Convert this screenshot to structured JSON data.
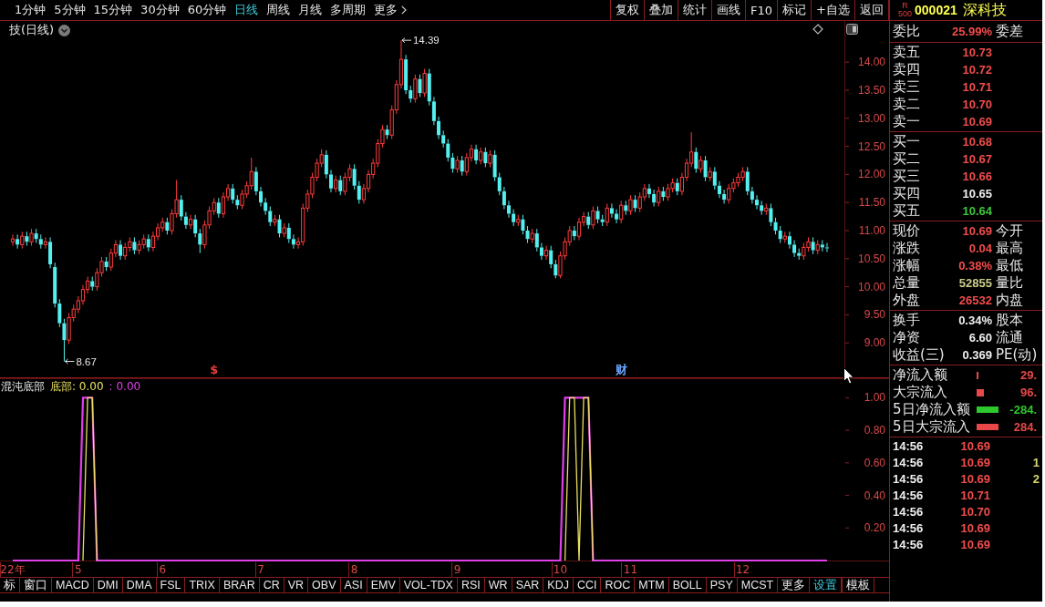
{
  "period_bar": {
    "periods": [
      {
        "label": "1分钟",
        "selected": false
      },
      {
        "label": "5分钟",
        "selected": false
      },
      {
        "label": "15分钟",
        "selected": false
      },
      {
        "label": "30分钟",
        "selected": false
      },
      {
        "label": "60分钟",
        "selected": false
      },
      {
        "label": "日线",
        "selected": true
      },
      {
        "label": "周线",
        "selected": false
      },
      {
        "label": "月线",
        "selected": false
      },
      {
        "label": "多周期",
        "selected": false
      }
    ],
    "more": "更多"
  },
  "toolbar": [
    "复权",
    "叠加",
    "统计",
    "画线",
    "F10",
    "标记",
    "+自选",
    "返回"
  ],
  "price_chart": {
    "title": "技(日线)",
    "marker_styles": [
      {
        "color": "#e83c3c"
      },
      {
        "color": "#6aa8ff"
      }
    ],
    "chart_data": {
      "type": "candlestick",
      "ylim": [
        8.37,
        14.75
      ],
      "yticks": [
        {
          "value": 9,
          "label": "9.00"
        },
        {
          "value": 9.5,
          "label": "9.50"
        },
        {
          "value": 10,
          "label": "10.00"
        },
        {
          "value": 10.5,
          "label": "10.50"
        },
        {
          "value": 11,
          "label": "11.00"
        },
        {
          "value": 11.5,
          "label": "11.50"
        },
        {
          "value": 12,
          "label": "12.00"
        },
        {
          "value": 12.5,
          "label": "12.50"
        },
        {
          "value": 13,
          "label": "13.00"
        },
        {
          "value": 13.5,
          "label": "13.50"
        },
        {
          "value": 14,
          "label": "14.00"
        }
      ],
      "categories": [
        null,
        null,
        null,
        null,
        null,
        null,
        null,
        null,
        null,
        null,
        null,
        null,
        null,
        null,
        null,
        null,
        null,
        null,
        null,
        null,
        null,
        null,
        null,
        null,
        null,
        null,
        null,
        null,
        null,
        null,
        null,
        null,
        null,
        null,
        null,
        null,
        null,
        null,
        null,
        null,
        null,
        null,
        null,
        "$",
        null,
        null,
        null,
        null,
        null,
        null,
        null,
        null,
        null,
        null,
        null,
        null,
        null,
        null,
        null,
        null,
        null,
        null,
        null,
        null,
        null,
        null,
        null,
        null,
        null,
        null,
        null,
        null,
        null,
        null,
        null,
        null,
        null,
        null,
        null,
        null,
        null,
        null,
        null,
        null,
        null,
        null,
        null,
        null,
        null,
        null,
        null,
        null,
        null,
        null,
        null,
        null,
        null,
        null,
        null,
        null,
        null,
        null,
        null,
        null,
        null,
        null,
        null,
        null,
        null,
        null,
        null,
        null,
        null,
        null,
        null,
        null,
        null,
        null,
        null,
        null,
        null,
        null,
        null,
        null,
        null,
        null,
        null,
        null,
        null,
        null,
        "财",
        null,
        null,
        null,
        null,
        null,
        null,
        null,
        null,
        null,
        null,
        null,
        null,
        null,
        null,
        null,
        null,
        null,
        null,
        null,
        null,
        null,
        null,
        null,
        null,
        null,
        null,
        null,
        null,
        null,
        null,
        null,
        null,
        null,
        null,
        null,
        null,
        null,
        null,
        null,
        null,
        null,
        null,
        null,
        null
      ],
      "ohlc": [
        [
          10.8,
          10.93,
          10.73,
          10.85
        ],
        [
          10.85,
          10.93,
          10.68,
          10.75
        ],
        [
          10.75,
          10.98,
          10.68,
          10.9
        ],
        [
          10.9,
          10.98,
          10.73,
          10.8
        ],
        [
          10.8,
          11.03,
          10.73,
          10.95
        ],
        [
          10.95,
          11.03,
          10.78,
          10.85
        ],
        [
          10.85,
          10.93,
          10.68,
          10.75
        ],
        [
          10.75,
          10.88,
          10.68,
          10.8
        ],
        [
          10.8,
          10.88,
          10.33,
          10.4
        ],
        [
          10.35,
          10.43,
          9.63,
          9.7
        ],
        [
          9.7,
          9.78,
          9.28,
          9.35
        ],
        [
          9.35,
          9.43,
          8.67,
          9.05
        ],
        [
          9.05,
          9.53,
          8.98,
          9.45
        ],
        [
          9.45,
          9.68,
          9.38,
          9.6
        ],
        [
          9.6,
          9.83,
          9.53,
          9.75
        ],
        [
          9.75,
          10.03,
          9.68,
          9.95
        ],
        [
          9.95,
          10.18,
          9.88,
          10.1
        ],
        [
          10.1,
          10.18,
          9.93,
          10.0
        ],
        [
          10.0,
          10.33,
          9.93,
          10.25
        ],
        [
          10.25,
          10.53,
          10.18,
          10.45
        ],
        [
          10.45,
          10.53,
          10.28,
          10.35
        ],
        [
          10.35,
          10.68,
          10.28,
          10.6
        ],
        [
          10.6,
          10.83,
          10.53,
          10.75
        ],
        [
          10.75,
          10.83,
          10.48,
          10.55
        ],
        [
          10.55,
          10.78,
          10.48,
          10.7
        ],
        [
          10.7,
          10.88,
          10.63,
          10.8
        ],
        [
          10.8,
          10.88,
          10.58,
          10.65
        ],
        [
          10.65,
          10.83,
          10.58,
          10.75
        ],
        [
          10.75,
          10.93,
          10.68,
          10.85
        ],
        [
          10.85,
          10.93,
          10.63,
          10.7
        ],
        [
          10.7,
          10.98,
          10.63,
          10.9
        ],
        [
          10.9,
          11.13,
          10.83,
          11.05
        ],
        [
          11.05,
          11.23,
          10.98,
          11.15
        ],
        [
          11.15,
          11.23,
          10.93,
          11.0
        ],
        [
          11.0,
          11.38,
          10.93,
          11.3
        ],
        [
          11.3,
          11.9,
          11.23,
          11.55
        ],
        [
          11.55,
          11.63,
          11.18,
          11.25
        ],
        [
          11.25,
          11.33,
          11.03,
          11.1
        ],
        [
          11.1,
          11.28,
          11.03,
          11.2
        ],
        [
          11.2,
          11.28,
          10.88,
          10.95
        ],
        [
          10.95,
          11.03,
          10.6,
          10.75
        ],
        [
          10.75,
          11.18,
          10.68,
          11.1
        ],
        [
          11.1,
          11.43,
          11.03,
          11.35
        ],
        [
          11.35,
          11.58,
          11.28,
          11.5
        ],
        [
          11.5,
          11.58,
          11.23,
          11.3
        ],
        [
          11.3,
          11.68,
          11.23,
          11.6
        ],
        [
          11.6,
          11.83,
          11.53,
          11.75
        ],
        [
          11.75,
          11.83,
          11.48,
          11.55
        ],
        [
          11.55,
          11.63,
          11.38,
          11.45
        ],
        [
          11.45,
          11.73,
          11.38,
          11.65
        ],
        [
          11.65,
          11.88,
          11.58,
          11.8
        ],
        [
          11.8,
          12.3,
          11.73,
          12.05
        ],
        [
          12.05,
          12.13,
          11.63,
          11.7
        ],
        [
          11.7,
          11.78,
          11.43,
          11.5
        ],
        [
          11.5,
          11.58,
          11.28,
          11.35
        ],
        [
          11.35,
          11.43,
          11.08,
          11.15
        ],
        [
          11.15,
          11.28,
          11.08,
          11.2
        ],
        [
          11.2,
          11.28,
          10.88,
          10.95
        ],
        [
          10.95,
          11.13,
          10.88,
          11.05
        ],
        [
          11.05,
          11.13,
          10.78,
          10.85
        ],
        [
          10.85,
          10.93,
          10.68,
          10.75
        ],
        [
          10.75,
          10.88,
          10.68,
          10.8
        ],
        [
          10.8,
          11.48,
          10.73,
          11.4
        ],
        [
          11.4,
          11.73,
          11.33,
          11.65
        ],
        [
          11.65,
          12.03,
          11.58,
          11.95
        ],
        [
          11.95,
          12.28,
          11.88,
          12.2
        ],
        [
          12.2,
          12.45,
          12.13,
          12.35
        ],
        [
          12.35,
          12.43,
          11.93,
          12.0
        ],
        [
          12.0,
          12.08,
          11.68,
          11.75
        ],
        [
          11.75,
          11.98,
          11.68,
          11.9
        ],
        [
          11.9,
          11.98,
          11.63,
          11.7
        ],
        [
          11.7,
          12.03,
          11.63,
          11.95
        ],
        [
          11.95,
          12.18,
          11.88,
          12.1
        ],
        [
          12.1,
          12.18,
          11.73,
          11.8
        ],
        [
          11.8,
          11.88,
          11.48,
          11.55
        ],
        [
          11.55,
          11.83,
          11.48,
          11.75
        ],
        [
          11.75,
          12.08,
          11.68,
          12.0
        ],
        [
          12.0,
          12.28,
          11.93,
          12.2
        ],
        [
          12.2,
          12.63,
          12.13,
          12.55
        ],
        [
          12.55,
          12.88,
          12.48,
          12.8
        ],
        [
          12.8,
          12.88,
          12.63,
          12.7
        ],
        [
          12.7,
          13.23,
          12.63,
          13.15
        ],
        [
          13.15,
          13.68,
          13.08,
          13.6
        ],
        [
          13.6,
          14.39,
          13.53,
          14.05
        ],
        [
          14.05,
          14.13,
          13.43,
          13.5
        ],
        [
          13.5,
          13.58,
          13.28,
          13.35
        ],
        [
          13.35,
          13.78,
          13.28,
          13.7
        ],
        [
          13.7,
          13.78,
          13.38,
          13.45
        ],
        [
          13.45,
          13.88,
          13.38,
          13.8
        ],
        [
          13.8,
          13.88,
          13.23,
          13.3
        ],
        [
          13.3,
          13.38,
          12.88,
          12.95
        ],
        [
          12.95,
          13.03,
          12.63,
          12.7
        ],
        [
          12.7,
          12.78,
          12.48,
          12.55
        ],
        [
          12.55,
          12.63,
          12.23,
          12.3
        ],
        [
          12.3,
          12.38,
          12.03,
          12.1
        ],
        [
          12.1,
          12.33,
          12.03,
          12.25
        ],
        [
          12.25,
          12.33,
          11.98,
          12.05
        ],
        [
          12.05,
          12.38,
          11.98,
          12.3
        ],
        [
          12.3,
          12.53,
          12.23,
          12.45
        ],
        [
          12.45,
          12.53,
          12.18,
          12.25
        ],
        [
          12.25,
          12.48,
          12.18,
          12.4
        ],
        [
          12.4,
          12.48,
          12.13,
          12.2
        ],
        [
          12.2,
          12.43,
          12.13,
          12.35
        ],
        [
          12.35,
          12.43,
          11.88,
          11.95
        ],
        [
          11.95,
          12.03,
          11.63,
          11.7
        ],
        [
          11.7,
          11.78,
          11.38,
          11.45
        ],
        [
          11.45,
          11.53,
          11.23,
          11.3
        ],
        [
          11.3,
          11.38,
          11.08,
          11.15
        ],
        [
          11.15,
          11.28,
          11.08,
          11.2
        ],
        [
          11.2,
          11.28,
          10.93,
          11.0
        ],
        [
          11.0,
          11.08,
          10.78,
          10.85
        ],
        [
          10.85,
          11.03,
          10.78,
          10.95
        ],
        [
          10.95,
          11.03,
          10.63,
          10.7
        ],
        [
          10.7,
          10.78,
          10.48,
          10.55
        ],
        [
          10.55,
          10.73,
          10.48,
          10.65
        ],
        [
          10.65,
          10.73,
          10.33,
          10.4
        ],
        [
          10.4,
          10.48,
          10.15,
          10.2
        ],
        [
          10.2,
          10.63,
          10.15,
          10.55
        ],
        [
          10.55,
          10.88,
          10.48,
          10.8
        ],
        [
          10.8,
          11.08,
          10.73,
          11.0
        ],
        [
          11.0,
          11.08,
          10.83,
          10.9
        ],
        [
          10.9,
          11.23,
          10.83,
          11.15
        ],
        [
          11.15,
          11.33,
          11.08,
          11.25
        ],
        [
          11.25,
          11.33,
          11.03,
          11.1
        ],
        [
          11.1,
          11.43,
          11.03,
          11.35
        ],
        [
          11.35,
          11.43,
          11.13,
          11.2
        ],
        [
          11.2,
          11.28,
          11.08,
          11.15
        ],
        [
          11.15,
          11.48,
          11.08,
          11.4
        ],
        [
          11.4,
          11.48,
          11.23,
          11.3
        ],
        [
          11.3,
          11.38,
          11.13,
          11.2
        ],
        [
          11.2,
          11.53,
          11.13,
          11.45
        ],
        [
          11.45,
          11.53,
          11.28,
          11.35
        ],
        [
          11.35,
          11.63,
          11.28,
          11.55
        ],
        [
          11.55,
          11.63,
          11.33,
          11.4
        ],
        [
          11.4,
          11.68,
          11.33,
          11.6
        ],
        [
          11.6,
          11.83,
          11.53,
          11.75
        ],
        [
          11.75,
          11.83,
          11.58,
          11.65
        ],
        [
          11.65,
          11.73,
          11.43,
          11.5
        ],
        [
          11.5,
          11.78,
          11.43,
          11.7
        ],
        [
          11.7,
          11.78,
          11.53,
          11.6
        ],
        [
          11.6,
          11.83,
          11.53,
          11.75
        ],
        [
          11.75,
          11.93,
          11.68,
          11.85
        ],
        [
          11.85,
          11.93,
          11.63,
          11.7
        ],
        [
          11.7,
          12.03,
          11.63,
          11.95
        ],
        [
          11.95,
          12.28,
          11.88,
          12.2
        ],
        [
          12.2,
          12.75,
          12.13,
          12.4
        ],
        [
          12.4,
          12.48,
          12.03,
          12.1
        ],
        [
          12.1,
          12.33,
          12.03,
          12.25
        ],
        [
          12.25,
          12.33,
          11.88,
          11.95
        ],
        [
          11.95,
          12.13,
          11.88,
          12.05
        ],
        [
          12.05,
          12.13,
          11.73,
          11.8
        ],
        [
          11.8,
          11.88,
          11.58,
          11.65
        ],
        [
          11.65,
          11.73,
          11.48,
          11.55
        ],
        [
          11.55,
          11.83,
          11.48,
          11.75
        ],
        [
          11.75,
          11.93,
          11.68,
          11.85
        ],
        [
          11.85,
          12.03,
          11.78,
          11.95
        ],
        [
          11.95,
          12.13,
          11.88,
          12.05
        ],
        [
          12.05,
          12.13,
          11.63,
          11.7
        ],
        [
          11.7,
          11.78,
          11.48,
          11.55
        ],
        [
          11.55,
          11.63,
          11.38,
          11.45
        ],
        [
          11.45,
          11.53,
          11.28,
          11.35
        ],
        [
          11.35,
          11.48,
          11.28,
          11.4
        ],
        [
          11.4,
          11.48,
          11.08,
          11.15
        ],
        [
          11.15,
          11.23,
          10.93,
          11.0
        ],
        [
          11.0,
          11.08,
          10.78,
          10.85
        ],
        [
          10.85,
          10.98,
          10.78,
          10.9
        ],
        [
          10.9,
          10.98,
          10.68,
          10.75
        ],
        [
          10.75,
          10.83,
          10.53,
          10.6
        ],
        [
          10.6,
          10.68,
          10.48,
          10.55
        ],
        [
          10.55,
          10.78,
          10.48,
          10.7
        ],
        [
          10.7,
          10.88,
          10.63,
          10.8
        ],
        [
          10.8,
          10.88,
          10.58,
          10.65
        ],
        [
          10.65,
          10.83,
          10.58,
          10.75
        ],
        [
          10.75,
          10.83,
          10.63,
          10.7
        ],
        [
          10.7,
          10.78,
          10.62,
          10.69
        ]
      ],
      "annotations": [
        "14.39",
        "8.67"
      ]
    }
  },
  "indicator": {
    "name": "混沌底部",
    "readouts": [
      "底部: 0.00",
      ": 0.00"
    ],
    "chart_data": {
      "type": "line",
      "ylim": [
        0,
        1.12
      ],
      "yticks": [
        {
          "value": 0.2,
          "label": "0.20"
        },
        {
          "value": 0.4,
          "label": "0.40"
        },
        {
          "value": 0.6,
          "label": "0.60"
        },
        {
          "value": 0.8,
          "label": "0.80"
        },
        {
          "value": 1,
          "label": "1.00"
        }
      ],
      "categories": [
        "22年",
        null,
        null,
        null,
        null,
        null,
        null,
        null,
        null,
        null,
        null,
        null,
        null,
        null,
        "5",
        null,
        null,
        null,
        null,
        null,
        null,
        null,
        null,
        null,
        null,
        null,
        null,
        null,
        null,
        null,
        null,
        null,
        "6",
        null,
        null,
        null,
        null,
        null,
        null,
        null,
        null,
        null,
        null,
        null,
        null,
        null,
        null,
        null,
        null,
        null,
        null,
        null,
        null,
        "7",
        null,
        null,
        null,
        null,
        null,
        null,
        null,
        null,
        null,
        null,
        null,
        null,
        null,
        null,
        null,
        null,
        null,
        null,
        null,
        "8",
        null,
        null,
        null,
        null,
        null,
        null,
        null,
        null,
        null,
        null,
        null,
        null,
        null,
        null,
        null,
        null,
        null,
        null,
        null,
        null,
        null,
        "9",
        null,
        null,
        null,
        null,
        null,
        null,
        null,
        null,
        null,
        null,
        null,
        null,
        null,
        null,
        null,
        null,
        null,
        null,
        null,
        null,
        null,
        "10",
        null,
        null,
        null,
        null,
        null,
        null,
        null,
        null,
        null,
        null,
        null,
        null,
        null,
        null,
        "11",
        null,
        null,
        null,
        null,
        null,
        null,
        null,
        null,
        null,
        null,
        null,
        null,
        null,
        null,
        null,
        null,
        null,
        null,
        null,
        null,
        null,
        null,
        null,
        "12",
        null,
        null,
        null,
        null,
        null,
        null,
        null,
        null,
        null,
        null,
        null,
        null,
        null,
        null,
        null,
        null,
        null,
        null
      ],
      "series": [
        {
          "color": "#e8e060",
          "values": [
            null,
            null,
            null,
            null,
            null,
            null,
            null,
            null,
            null,
            null,
            null,
            null,
            null,
            null,
            null,
            0,
            1,
            1,
            0,
            null,
            null,
            null,
            null,
            null,
            null,
            null,
            null,
            null,
            null,
            null,
            null,
            null,
            null,
            null,
            null,
            null,
            null,
            null,
            null,
            null,
            null,
            null,
            null,
            null,
            null,
            null,
            null,
            null,
            null,
            null,
            null,
            null,
            null,
            null,
            null,
            null,
            null,
            null,
            null,
            null,
            null,
            null,
            null,
            null,
            null,
            null,
            null,
            null,
            null,
            null,
            null,
            null,
            null,
            null,
            null,
            null,
            null,
            null,
            null,
            null,
            null,
            null,
            null,
            null,
            null,
            null,
            null,
            null,
            null,
            null,
            null,
            null,
            null,
            null,
            null,
            null,
            null,
            null,
            null,
            null,
            null,
            null,
            null,
            null,
            null,
            null,
            null,
            null,
            null,
            null,
            null,
            null,
            null,
            null,
            null,
            null,
            null,
            null,
            0,
            1,
            1,
            0,
            1,
            1,
            0,
            null,
            null,
            null,
            null,
            null,
            null,
            null,
            null,
            null,
            null,
            null,
            null,
            null,
            null,
            null,
            null,
            null,
            null,
            null,
            null,
            null,
            null,
            null,
            null,
            null,
            null,
            null,
            null,
            null,
            null,
            null,
            null,
            null,
            null,
            null,
            null,
            null,
            null,
            null,
            null,
            null,
            null,
            null,
            null,
            null,
            null,
            null,
            null,
            null,
            null
          ]
        },
        {
          "color": "#e040e8",
          "values": [
            0,
            0,
            0,
            0,
            0,
            0,
            0,
            0,
            0,
            0,
            0,
            0,
            0,
            0,
            0,
            1,
            1,
            1,
            0,
            0,
            0,
            0,
            0,
            0,
            0,
            0,
            0,
            0,
            0,
            0,
            0,
            0,
            0,
            0,
            0,
            0,
            0,
            0,
            0,
            0,
            0,
            0,
            0,
            0,
            0,
            0,
            0,
            0,
            0,
            0,
            0,
            0,
            0,
            0,
            0,
            0,
            0,
            0,
            0,
            0,
            0,
            0,
            0,
            0,
            0,
            0,
            0,
            0,
            0,
            0,
            0,
            0,
            0,
            0,
            0,
            0,
            0,
            0,
            0,
            0,
            0,
            0,
            0,
            0,
            0,
            0,
            0,
            0,
            0,
            0,
            0,
            0,
            0,
            0,
            0,
            0,
            0,
            0,
            0,
            0,
            0,
            0,
            0,
            0,
            0,
            0,
            0,
            0,
            0,
            0,
            0,
            0,
            0,
            0,
            0,
            0,
            0,
            0,
            1,
            1,
            1,
            1,
            1,
            1,
            0,
            0,
            0,
            0,
            0,
            0,
            0,
            0,
            0,
            0,
            0,
            0,
            0,
            0,
            0,
            0,
            0,
            0,
            0,
            0,
            0,
            0,
            0,
            0,
            0,
            0,
            0,
            0,
            0,
            0,
            0,
            0,
            0,
            0,
            0,
            0,
            0,
            0,
            0,
            0,
            0,
            0,
            0,
            0,
            0,
            0,
            0,
            0,
            0,
            0,
            0
          ]
        }
      ]
    }
  },
  "indicator_tabs": [
    {
      "label": "标",
      "kind": "item"
    },
    {
      "label": "窗口",
      "kind": "item"
    },
    {
      "label": "MACD",
      "kind": "item"
    },
    {
      "label": "DMI",
      "kind": "item"
    },
    {
      "label": "DMA",
      "kind": "item"
    },
    {
      "label": "FSL",
      "kind": "item"
    },
    {
      "label": "TRIX",
      "kind": "item"
    },
    {
      "label": "BRAR",
      "kind": "item"
    },
    {
      "label": "CR",
      "kind": "item"
    },
    {
      "label": "VR",
      "kind": "item"
    },
    {
      "label": "OBV",
      "kind": "item"
    },
    {
      "label": "ASI",
      "kind": "item"
    },
    {
      "label": "EMV",
      "kind": "item"
    },
    {
      "label": "VOL-TDX",
      "kind": "item"
    },
    {
      "label": "RSI",
      "kind": "item"
    },
    {
      "label": "WR",
      "kind": "item"
    },
    {
      "label": "SAR",
      "kind": "item"
    },
    {
      "label": "KDJ",
      "kind": "item"
    },
    {
      "label": "CCI",
      "kind": "item"
    },
    {
      "label": "ROC",
      "kind": "item"
    },
    {
      "label": "MTM",
      "kind": "item"
    },
    {
      "label": "BOLL",
      "kind": "item"
    },
    {
      "label": "PSY",
      "kind": "item"
    },
    {
      "label": "MCST",
      "kind": "item"
    },
    {
      "label": "更多",
      "kind": "item"
    },
    {
      "label": "设置",
      "kind": "settings"
    }
  ],
  "template_button": "模板",
  "quote": {
    "badge": [
      "R",
      "500"
    ],
    "code": "000021",
    "name": "深科技",
    "ratio": [
      {
        "label": "委比",
        "value": "25.99%",
        "color": "#f24c4c",
        "label_2": "委差"
      }
    ],
    "asks": [
      {
        "label": "卖五",
        "value": "10.73",
        "color": "#f24c4c"
      },
      {
        "label": "卖四",
        "value": "10.72",
        "color": "#f24c4c"
      },
      {
        "label": "卖三",
        "value": "10.71",
        "color": "#f24c4c"
      },
      {
        "label": "卖二",
        "value": "10.70",
        "color": "#f24c4c"
      },
      {
        "label": "卖一",
        "value": "10.69",
        "color": "#f24c4c"
      }
    ],
    "bids": [
      {
        "label": "买一",
        "value": "10.68",
        "color": "#f24c4c"
      },
      {
        "label": "买二",
        "value": "10.67",
        "color": "#f24c4c"
      },
      {
        "label": "买三",
        "value": "10.66",
        "color": "#f24c4c"
      },
      {
        "label": "买四",
        "value": "10.65",
        "color": "#f0f0f0"
      },
      {
        "label": "买五",
        "value": "10.64",
        "color": "#3cc83c"
      }
    ],
    "stats": [
      {
        "label": "现价",
        "value": "10.69",
        "color": "#f24c4c",
        "label_2": "今开"
      },
      {
        "label": "涨跌",
        "value": "0.04",
        "color": "#f24c4c",
        "label_2": "最高"
      },
      {
        "label": "涨幅",
        "value": "0.38%",
        "color": "#f24c4c",
        "label_2": "最低"
      },
      {
        "label": "总量",
        "value": "52855",
        "color": "#cdcd8c",
        "label_2": "量比"
      },
      {
        "label": "外盘",
        "value": "26532",
        "color": "#f24c4c",
        "label_2": "内盘"
      }
    ],
    "fundamentals": [
      {
        "label": "换手",
        "value": "0.34%",
        "color": "#f0f0f0",
        "label_2": "股本"
      },
      {
        "label": "净资",
        "value": "6.60",
        "color": "#f0f0f0",
        "label_2": "流通"
      },
      {
        "label": "收益(三)",
        "value": "0.369",
        "color": "#f0f0f0",
        "label_2": "PE(动)"
      }
    ],
    "flows": [
      {
        "label": "净流入额",
        "kind": "tick",
        "color": "#e84848",
        "value": "29."
      },
      {
        "label": "大宗流入",
        "kind": "square",
        "color": "#e84848",
        "value": "96."
      },
      {
        "label": "5日净流入额",
        "kind": "bar",
        "color": "#2cc82c",
        "value": "-284."
      },
      {
        "label": "5日大宗流入",
        "kind": "bar",
        "color": "#e84848",
        "value": "284."
      }
    ],
    "ticks": [
      {
        "time": "14:56",
        "price": "10.69",
        "color": "#f24c4c"
      },
      {
        "time": "14:56",
        "price": "10.69",
        "color": "#f24c4c",
        "column_3": "1"
      },
      {
        "time": "14:56",
        "price": "10.69",
        "color": "#f24c4c",
        "column_3": "2"
      },
      {
        "time": "14:56",
        "price": "10.71",
        "color": "#f24c4c"
      },
      {
        "time": "14:56",
        "price": "10.70",
        "color": "#f24c4c"
      },
      {
        "time": "14:56",
        "price": "10.69",
        "color": "#f24c4c"
      },
      {
        "time": "14:56",
        "price": "10.69",
        "color": "#f24c4c"
      }
    ]
  }
}
